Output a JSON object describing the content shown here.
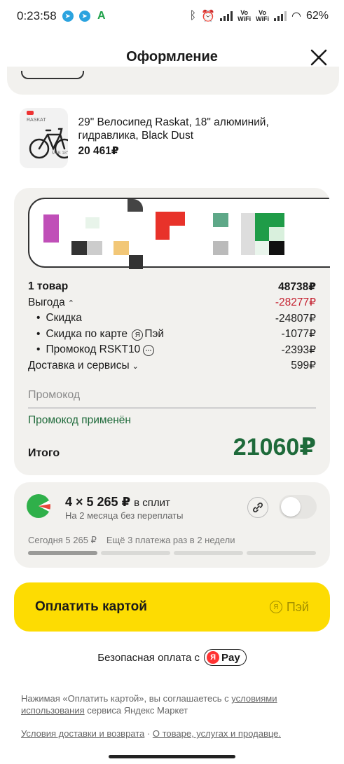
{
  "status_bar": {
    "time": "0:23:58",
    "battery": "62%",
    "vo_wifi": "Vo\nWiFi"
  },
  "header": {
    "title": "Оформление"
  },
  "product": {
    "name": "29\" Велосипед Raskat, 18\" алюминий, гидравлика, Black Dust",
    "price": "20 461₽",
    "img_brand": "RASKAT",
    "img_caption": "MTB 18\""
  },
  "summary": {
    "items_label": "1 товар",
    "items_value": "48738₽",
    "benefit_label": "Выгода",
    "benefit_value": "-28277₽",
    "discount_label": "Скидка",
    "discount_value": "-24807₽",
    "card_discount_label_a": "Скидка по карте",
    "card_discount_label_b": "Пэй",
    "card_discount_value": "-1077₽",
    "promo_code_label": "Промокод RSKT10",
    "promo_code_value": "-2393₽",
    "delivery_label": "Доставка и сервисы",
    "delivery_value": "599₽",
    "promo_placeholder": "Промокод",
    "promo_applied": "Промокод применён",
    "total_label": "Итого",
    "total_value": "21060₽"
  },
  "split": {
    "title": "4 × 5 265 ₽",
    "title_suffix": "в сплит",
    "subtitle": "На 2 месяца без переплаты",
    "today": "Сегодня 5 265 ₽",
    "later": "Ещё 3 платежа раз в 2 недели",
    "enabled": false
  },
  "pay_button": {
    "label": "Оплатить картой",
    "ya_label": "Пэй"
  },
  "secure": {
    "text": "Безопасная оплата с",
    "logo_text": "Pay"
  },
  "legal": {
    "text_a": "Нажимая «Оплатить картой», вы соглашаетесь с",
    "link_terms": "условиями использования",
    "text_b": "сервиса Яндекс Маркет",
    "link_delivery": "Условия доставки и возврата",
    "link_about": "О товаре, услугах и продавце."
  },
  "colors": {
    "accent_yellow": "#fddc02",
    "green": "#1e6a3a",
    "red": "#c4202f"
  }
}
